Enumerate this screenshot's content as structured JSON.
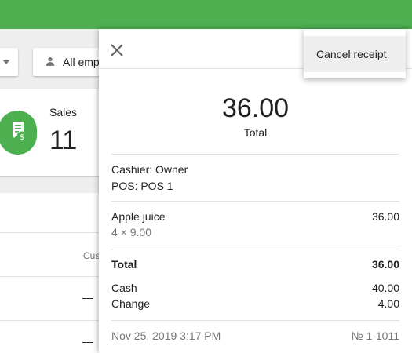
{
  "background": {
    "employee_filter_label": "All employees",
    "sales_card": {
      "label": "Sales",
      "value": "11"
    },
    "table": {
      "customer_header": "Customer",
      "rows": [
        "—",
        "—"
      ]
    }
  },
  "receipt": {
    "total_amount": "36.00",
    "total_label": "Total",
    "cashier": "Cashier: Owner",
    "pos": "POS: POS 1",
    "item": {
      "name": "Apple juice",
      "qty_price": "4 × 9.00",
      "amount": "36.00"
    },
    "summary": {
      "total_label": "Total",
      "total_value": "36.00",
      "cash_label": "Cash",
      "cash_value": "40.00",
      "change_label": "Change",
      "change_value": "4.00"
    },
    "datetime": "Nov 25, 2019 3:17 PM",
    "number": "№ 1-1011"
  },
  "menu": {
    "cancel_receipt": "Cancel receipt"
  },
  "colors": {
    "brand_green": "#4caf50",
    "menu_highlight": "#eeeeee"
  },
  "icons": [
    "person-icon",
    "receipt-dollar-icon",
    "close-icon",
    "chevron-down-icon"
  ]
}
